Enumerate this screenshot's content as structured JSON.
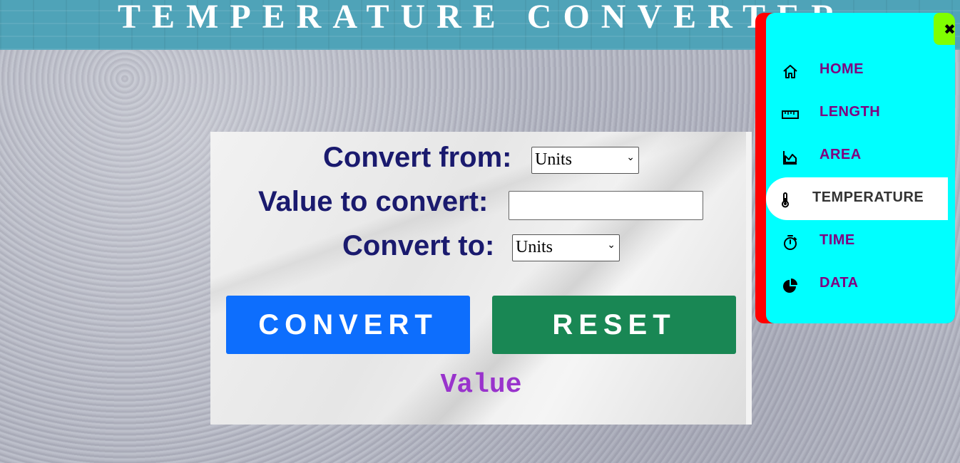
{
  "header": {
    "title": "TEMPERATURE CONVERTER"
  },
  "form": {
    "from_label": "Convert from:",
    "from_select": "Units",
    "value_label": "Value to convert:",
    "value_input": "",
    "to_label": "Convert to:",
    "to_select": "Units",
    "convert_label": "CONVERT",
    "reset_label": "RESET",
    "result": "Value"
  },
  "sidebar": {
    "close_icon": "✖",
    "items": [
      {
        "label": "HOME",
        "icon": "home-icon"
      },
      {
        "label": "LENGTH",
        "icon": "ruler-icon"
      },
      {
        "label": "AREA",
        "icon": "area-chart-icon"
      },
      {
        "label": "TEMPERATURE",
        "icon": "thermometer-icon",
        "active": true
      },
      {
        "label": "TIME",
        "icon": "stopwatch-icon"
      },
      {
        "label": "DATA",
        "icon": "pie-chart-icon"
      }
    ]
  },
  "colors": {
    "header_bg": "#4fa3b8",
    "label_text": "#1a1a6e",
    "convert_button": "#0d6efd",
    "reset_button": "#198754",
    "result_text": "#9933cc",
    "sidebar_bg": "#00ffff",
    "sidebar_accent": "#ff0000",
    "close_button": "#80ff00",
    "nav_text": "#800080",
    "nav_active_text": "#333333"
  }
}
